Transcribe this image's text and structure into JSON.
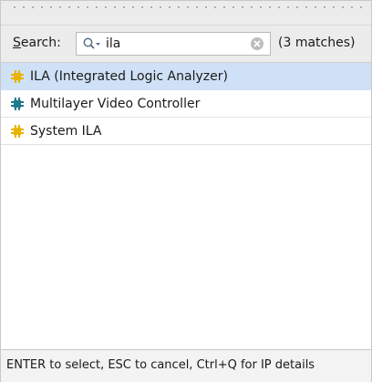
{
  "search": {
    "label_underlined": "S",
    "label_rest": "earch:",
    "value": "ila",
    "match_count": "(3 matches)"
  },
  "results": [
    {
      "label": "ILA (Integrated Logic Analyzer)",
      "icon": "ip-core-icon",
      "icon_color": "#e8b400",
      "selected": true
    },
    {
      "label": "Multilayer Video Controller",
      "icon": "ip-core-icon",
      "icon_color": "#1f7a8c",
      "selected": false
    },
    {
      "label": "System ILA",
      "icon": "ip-core-icon",
      "icon_color": "#e8b400",
      "selected": false
    }
  ],
  "status": {
    "text": "ENTER to select, ESC to cancel, Ctrl+Q for IP details"
  },
  "colors": {
    "selection": "#cfe1f7",
    "panel_bg": "#ececec"
  }
}
